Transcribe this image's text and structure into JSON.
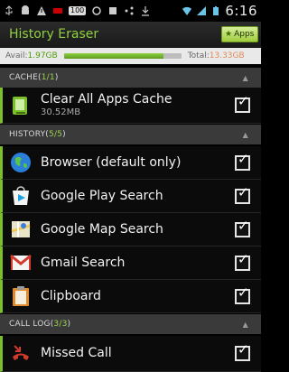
{
  "status_bar": {
    "time": "6:16",
    "battery_text": "100",
    "icons": [
      "usb-icon",
      "android-icon",
      "warning-icon",
      "battery-small-icon",
      "sync-icon",
      "media-icon",
      "share-icon",
      "download-icon",
      "wifi-icon",
      "signal-icon",
      "battery-icon"
    ]
  },
  "title_bar": {
    "title": "History Eraser",
    "apps_button": "Apps"
  },
  "storage": {
    "avail_label": "Avail: ",
    "avail_value": "1.97GB",
    "total_label": "Total: ",
    "total_value": "13.33GB",
    "used_fraction": 0.85
  },
  "sections": [
    {
      "name": "CACHE",
      "count": "1/1",
      "items": [
        {
          "label": "Clear All Apps Cache",
          "sub": "30.52MB",
          "icon": "android-apps-icon",
          "checked": true
        }
      ]
    },
    {
      "name": "HISTORY",
      "count": "5/5",
      "items": [
        {
          "label": "Browser (default only)",
          "icon": "browser-globe-icon",
          "checked": true
        },
        {
          "label": "Google Play Search",
          "icon": "google-play-icon",
          "checked": true
        },
        {
          "label": "Google Map Search",
          "icon": "google-maps-icon",
          "checked": true
        },
        {
          "label": "Gmail Search",
          "icon": "gmail-icon",
          "checked": true
        },
        {
          "label": "Clipboard",
          "icon": "clipboard-icon",
          "checked": true
        }
      ]
    },
    {
      "name": "CALL LOG",
      "count": "3/3",
      "items": [
        {
          "label": "Missed Call",
          "icon": "missed-call-icon",
          "checked": true
        }
      ]
    }
  ],
  "colors": {
    "accent": "#8fd13f",
    "section_bg": "#3a3a3a",
    "row_bg": "#0b0b0b"
  }
}
